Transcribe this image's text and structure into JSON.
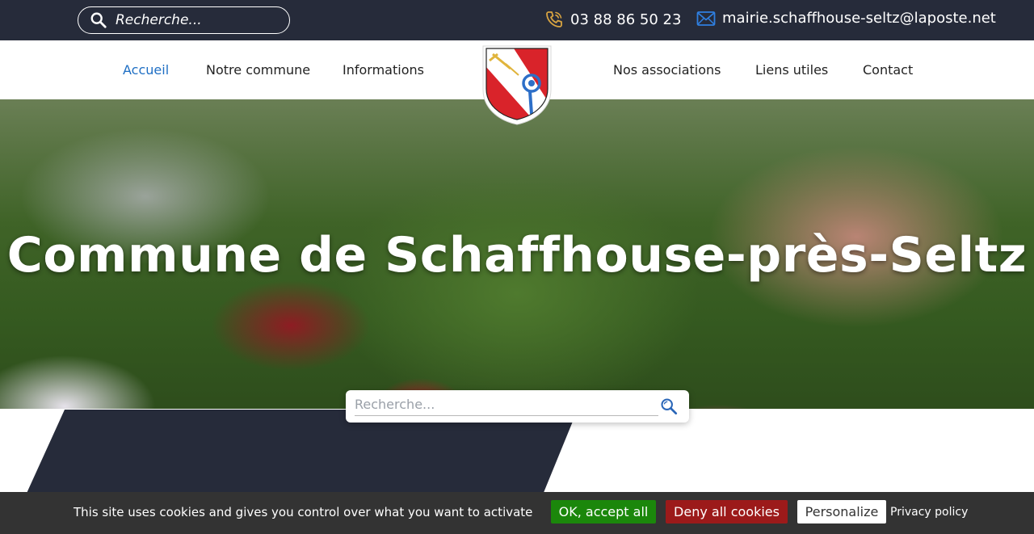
{
  "topbar": {
    "search_placeholder": "Recherche...",
    "phone": "03 88 86 50 23",
    "email": "mairie.schaffhouse-seltz@laposte.net"
  },
  "nav": {
    "items": [
      {
        "label": "Accueil",
        "active": true
      },
      {
        "label": "Notre commune"
      },
      {
        "label": "Informations"
      },
      {
        "label": "Nos associations"
      },
      {
        "label": "Liens utiles"
      },
      {
        "label": "Contact"
      }
    ]
  },
  "hero": {
    "title": "Commune de Schaffhouse-près-Seltz"
  },
  "search": {
    "placeholder": "Recherche..."
  },
  "cookies": {
    "message": "This site uses cookies and gives you control over what you want to activate",
    "accept_label": "OK, accept all",
    "deny_label": "Deny all cookies",
    "personalize_label": "Personalize",
    "privacy_label": "Privacy policy"
  },
  "colors": {
    "dark": "#262b3a",
    "accent_blue": "#1f6fc4",
    "phone_icon": "#d9a441",
    "mail_icon": "#2f7fe0",
    "accept_green": "#1b870b",
    "deny_red": "#9c1a1a"
  },
  "icons": {
    "top_search": "search-icon",
    "phone": "phone-icon",
    "mail": "mail-icon",
    "crest": "coat-of-arms-logo",
    "main_search": "search-icon"
  }
}
